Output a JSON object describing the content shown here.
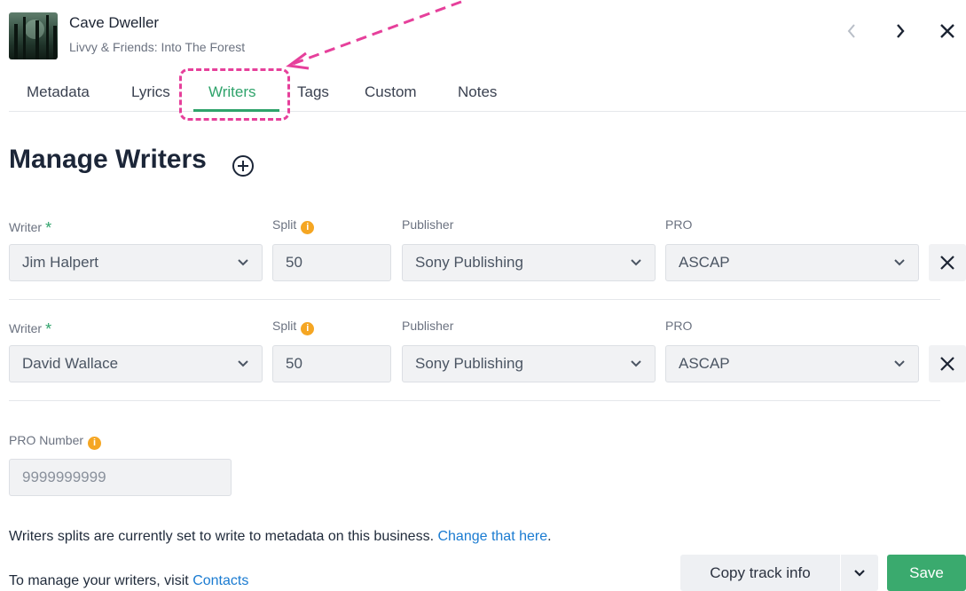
{
  "track": {
    "title": "Cave Dweller",
    "subtitle": "Livvy & Friends: Into The Forest"
  },
  "tabs": [
    {
      "label": "Metadata"
    },
    {
      "label": "Lyrics"
    },
    {
      "label": "Writers",
      "active": true
    },
    {
      "label": "Tags"
    },
    {
      "label": "Custom"
    },
    {
      "label": "Notes"
    }
  ],
  "section": {
    "title": "Manage Writers"
  },
  "labels": {
    "writer": "Writer",
    "required_mark": "*",
    "split": "Split",
    "publisher": "Publisher",
    "pro": "PRO",
    "pro_number": "PRO Number",
    "info_glyph": "i"
  },
  "writers": [
    {
      "writer": "Jim Halpert",
      "split": "50",
      "publisher": "Sony Publishing",
      "pro": "ASCAP"
    },
    {
      "writer": "David Wallace",
      "split": "50",
      "publisher": "Sony Publishing",
      "pro": "ASCAP"
    }
  ],
  "pro_number": {
    "value": "9999999999"
  },
  "footer": {
    "splits_text": "Writers splits are currently set to write to metadata on this business.",
    "splits_link": "Change that here",
    "splits_end": ".",
    "manage_text": "To manage your writers, visit",
    "manage_link": "Contacts"
  },
  "buttons": {
    "copy_track_info": "Copy track info",
    "save": "Save"
  },
  "colors": {
    "accent": "#2fa36b",
    "annotation": "#e6409b",
    "link": "#1a7bd1",
    "info": "#f5a623",
    "save": "#3aaa6e"
  },
  "icons": [
    "album-art",
    "chevron-left-icon",
    "chevron-right-icon",
    "close-icon",
    "plus-circle-icon",
    "info-icon",
    "chevron-down-icon",
    "remove-icon"
  ]
}
